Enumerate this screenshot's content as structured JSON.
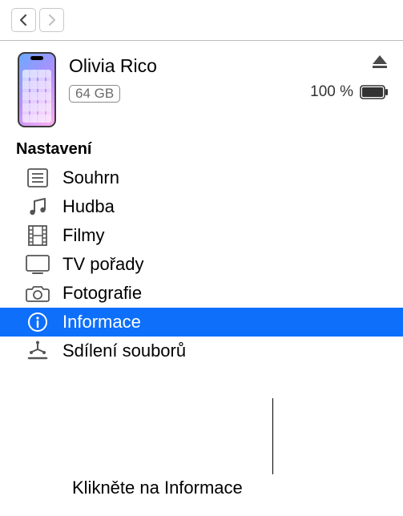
{
  "device": {
    "name": "Olivia Rico",
    "capacity": "64 GB",
    "battery_percent": "100 %"
  },
  "section_title": "Nastavení",
  "menu": {
    "summary": "Souhrn",
    "music": "Hudba",
    "movies": "Filmy",
    "tv": "TV pořady",
    "photos": "Fotografie",
    "info": "Informace",
    "filesharing": "Sdílení souborů"
  },
  "callout": "Klikněte na Informace"
}
